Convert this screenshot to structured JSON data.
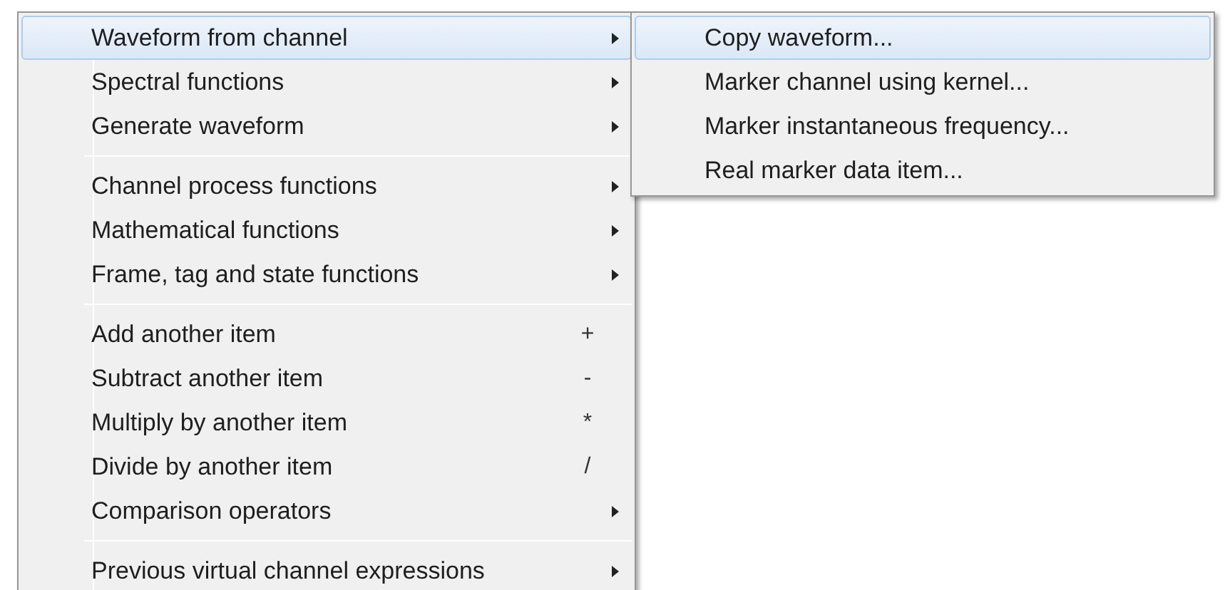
{
  "menu": {
    "groups": [
      [
        {
          "label": "Waveform from channel",
          "submenu": true,
          "selected": true
        },
        {
          "label": "Spectral functions",
          "submenu": true,
          "selected": false
        },
        {
          "label": "Generate waveform",
          "submenu": true,
          "selected": false
        }
      ],
      [
        {
          "label": "Channel process functions",
          "submenu": true,
          "selected": false
        },
        {
          "label": "Mathematical functions",
          "submenu": true,
          "selected": false
        },
        {
          "label": "Frame, tag and state functions",
          "submenu": true,
          "selected": false
        }
      ],
      [
        {
          "label": "Add another item",
          "shortcut": "+",
          "submenu": false,
          "selected": false
        },
        {
          "label": "Subtract another item",
          "shortcut": "-",
          "submenu": false,
          "selected": false
        },
        {
          "label": "Multiply by another item",
          "shortcut": "*",
          "submenu": false,
          "selected": false
        },
        {
          "label": "Divide by another item",
          "shortcut": "/",
          "submenu": false,
          "selected": false
        },
        {
          "label": "Comparison operators",
          "submenu": true,
          "selected": false
        }
      ],
      [
        {
          "label": "Previous virtual channel expressions",
          "submenu": true,
          "selected": false
        }
      ]
    ]
  },
  "submenu": {
    "items": [
      {
        "label": "Copy waveform...",
        "selected": true
      },
      {
        "label": "Marker channel using kernel...",
        "selected": false
      },
      {
        "label": "Marker instantaneous frequency...",
        "selected": false
      },
      {
        "label": "Real marker data item...",
        "selected": false
      }
    ]
  }
}
